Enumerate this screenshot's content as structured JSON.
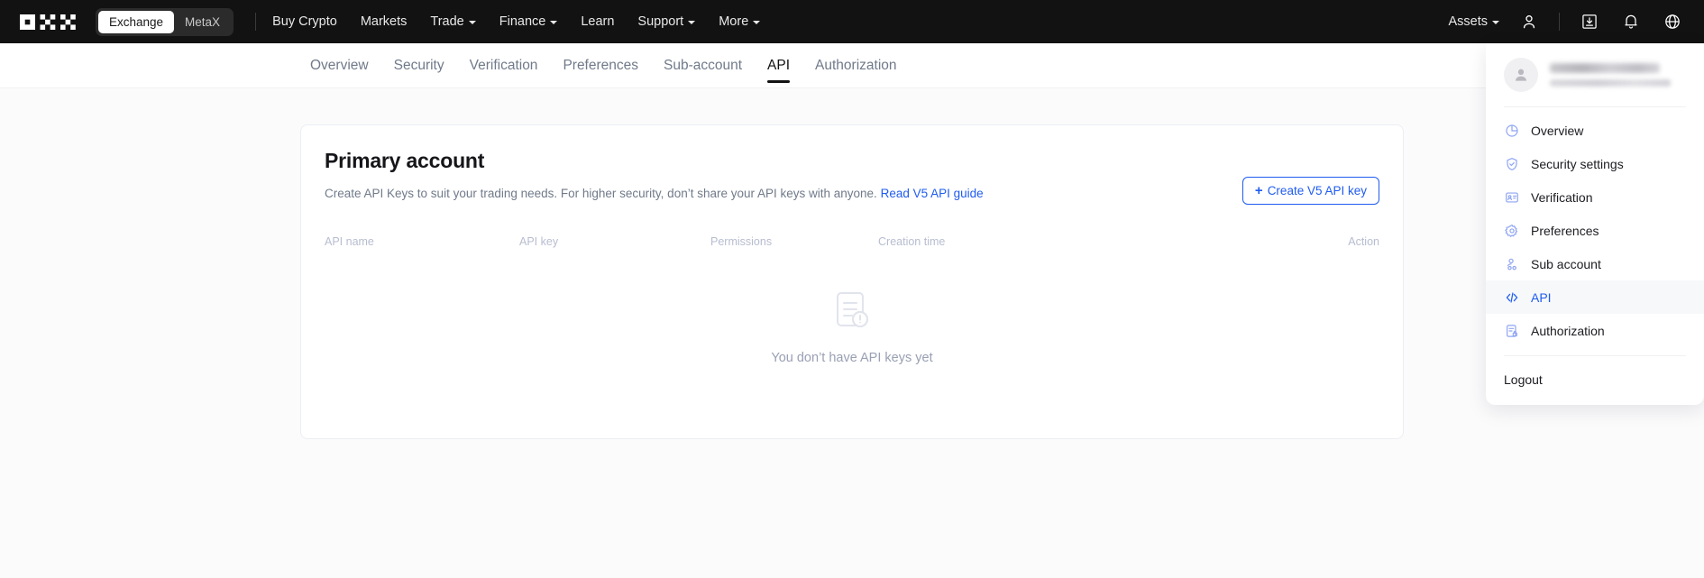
{
  "topnav": {
    "logo_name": "okx-logo",
    "segmented": [
      {
        "label": "Exchange",
        "active": true
      },
      {
        "label": "MetaX",
        "active": false
      }
    ],
    "links": [
      {
        "label": "Buy Crypto",
        "caret": false
      },
      {
        "label": "Markets",
        "caret": false
      },
      {
        "label": "Trade",
        "caret": true
      },
      {
        "label": "Finance",
        "caret": true
      },
      {
        "label": "Learn",
        "caret": false
      },
      {
        "label": "Support",
        "caret": true
      },
      {
        "label": "More",
        "caret": true
      }
    ],
    "assets_label": "Assets",
    "icons": [
      "user-icon",
      "download-icon",
      "bell-icon",
      "globe-icon"
    ]
  },
  "subnav": {
    "items": [
      {
        "label": "Overview",
        "active": false
      },
      {
        "label": "Security",
        "active": false
      },
      {
        "label": "Verification",
        "active": false
      },
      {
        "label": "Preferences",
        "active": false
      },
      {
        "label": "Sub-account",
        "active": false
      },
      {
        "label": "API",
        "active": true
      },
      {
        "label": "Authorization",
        "active": false
      }
    ]
  },
  "card": {
    "title": "Primary account",
    "description": "Create API Keys to suit your trading needs. For higher security, don’t share your API keys with anyone. ",
    "guide_link": "Read V5 API guide",
    "create_button": "Create V5 API key",
    "create_button_plus": "+",
    "table": {
      "headers": [
        "API name",
        "API key",
        "Permissions",
        "Creation time",
        "Action"
      ],
      "rows": [],
      "empty_text": "You don’t have API keys yet",
      "empty_icon": "document-alert-icon"
    }
  },
  "dropdown": {
    "profile": {
      "avatar_icon": "user-avatar-icon",
      "name_redacted": "",
      "detail_redacted": ""
    },
    "items": [
      {
        "label": "Overview",
        "icon": "pie-chart-icon",
        "active": false
      },
      {
        "label": "Security settings",
        "icon": "shield-check-icon",
        "active": false
      },
      {
        "label": "Verification",
        "icon": "id-card-icon",
        "active": false
      },
      {
        "label": "Preferences",
        "icon": "gear-icon",
        "active": false
      },
      {
        "label": "Sub account",
        "icon": "users-icon",
        "active": false
      },
      {
        "label": "API",
        "icon": "code-icon",
        "active": true
      },
      {
        "label": "Authorization",
        "icon": "document-lock-icon",
        "active": false
      }
    ],
    "logout_label": "Logout"
  },
  "colors": {
    "brand_blue": "#1f5cf0",
    "nav_dark": "#121212",
    "page_bg": "#fbfbfc",
    "muted_text": "#707a8a",
    "table_header": "#b7bdd0"
  }
}
